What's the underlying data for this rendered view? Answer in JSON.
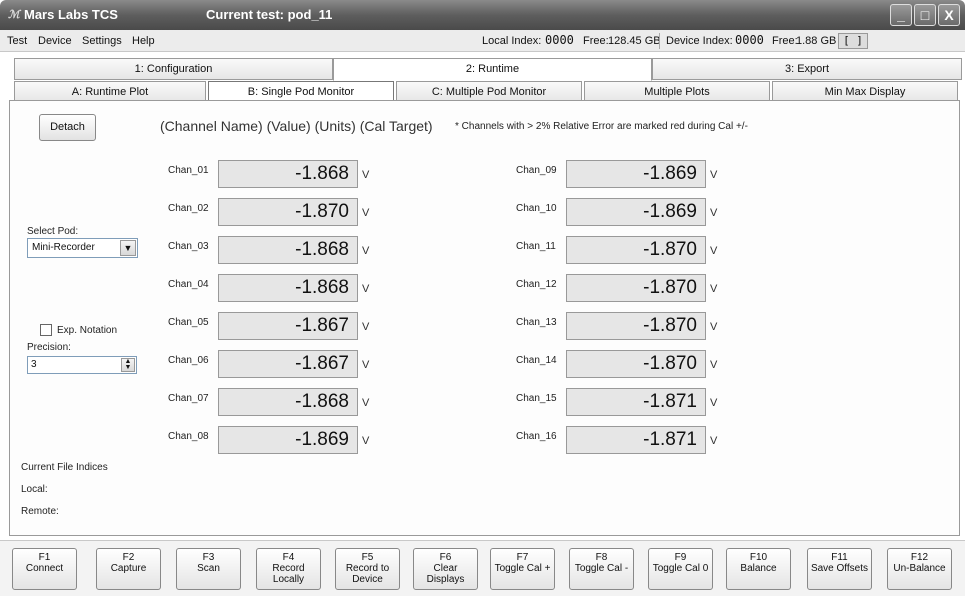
{
  "window": {
    "app_title": "Mars Labs TCS",
    "current_test": "Current test: pod_11",
    "buttons": [
      "_",
      "□",
      "X"
    ]
  },
  "menu": {
    "items": [
      "Test",
      "Device",
      "Settings",
      "Help"
    ],
    "local_index_label": "Local Index:",
    "local_index_value": "0000",
    "local_free_label": "Free:",
    "local_free_value": "128.45 GB",
    "device_index_label": "Device Index:",
    "device_index_value": "0000",
    "device_free_label": "Free:",
    "device_free_value": "1.88 GB",
    "bracket_button": "[ ]"
  },
  "main_tabs": [
    "1: Configuration",
    "2: Runtime",
    "3: Export"
  ],
  "sub_tabs": [
    "A: Runtime Plot",
    "B: Single Pod Monitor",
    "C: Multiple Pod Monitor",
    "Multiple Plots",
    "Min Max Display"
  ],
  "panel": {
    "detach_label": "Detach",
    "header": "(Channel Name)  (Value)  (Units)  (Cal Target)",
    "note": "* Channels with > 2% Relative Error are marked red during Cal +/-",
    "select_pod_label": "Select Pod:",
    "select_pod_value": "Mini-Recorder",
    "exp_notation_label": "Exp. Notation",
    "precision_label": "Precision:",
    "precision_value": "3",
    "current_file_indices_label": "Current File Indices",
    "local_label": "Local:",
    "remote_label": "Remote:"
  },
  "channels": [
    {
      "name": "Chan_01",
      "value": "-1.868",
      "unit": "V"
    },
    {
      "name": "Chan_02",
      "value": "-1.870",
      "unit": "V"
    },
    {
      "name": "Chan_03",
      "value": "-1.868",
      "unit": "V"
    },
    {
      "name": "Chan_04",
      "value": "-1.868",
      "unit": "V"
    },
    {
      "name": "Chan_05",
      "value": "-1.867",
      "unit": "V"
    },
    {
      "name": "Chan_06",
      "value": "-1.867",
      "unit": "V"
    },
    {
      "name": "Chan_07",
      "value": "-1.868",
      "unit": "V"
    },
    {
      "name": "Chan_08",
      "value": "-1.869",
      "unit": "V"
    },
    {
      "name": "Chan_09",
      "value": "-1.869",
      "unit": "V"
    },
    {
      "name": "Chan_10",
      "value": "-1.869",
      "unit": "V"
    },
    {
      "name": "Chan_11",
      "value": "-1.870",
      "unit": "V"
    },
    {
      "name": "Chan_12",
      "value": "-1.870",
      "unit": "V"
    },
    {
      "name": "Chan_13",
      "value": "-1.870",
      "unit": "V"
    },
    {
      "name": "Chan_14",
      "value": "-1.870",
      "unit": "V"
    },
    {
      "name": "Chan_15",
      "value": "-1.871",
      "unit": "V"
    },
    {
      "name": "Chan_16",
      "value": "-1.871",
      "unit": "V"
    }
  ],
  "function_keys": [
    {
      "key": "F1",
      "label": "Connect"
    },
    {
      "key": "F2",
      "label": "Capture"
    },
    {
      "key": "F3",
      "label": "Scan"
    },
    {
      "key": "F4",
      "label": "Record Locally"
    },
    {
      "key": "F5",
      "label": "Record to Device"
    },
    {
      "key": "F6",
      "label": "Clear Displays"
    },
    {
      "key": "F7",
      "label": "Toggle Cal +"
    },
    {
      "key": "F8",
      "label": "Toggle Cal -"
    },
    {
      "key": "F9",
      "label": "Toggle Cal 0"
    },
    {
      "key": "F10",
      "label": "Balance"
    },
    {
      "key": "F11",
      "label": "Save Offsets"
    },
    {
      "key": "F12",
      "label": "Un-Balance"
    }
  ]
}
